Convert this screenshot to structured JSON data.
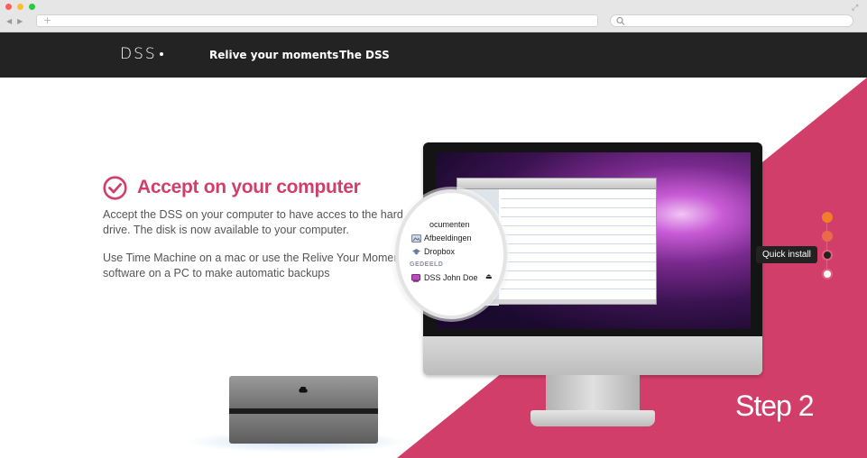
{
  "browser": {
    "window_buttons": [
      {
        "name": "close",
        "color": "#fe5f57"
      },
      {
        "name": "minimize",
        "color": "#febc2e"
      },
      {
        "name": "maximize",
        "color": "#28c840"
      }
    ],
    "new_tab_symbol": "+",
    "icons": [
      "back-icon",
      "forward-icon",
      "search-icon",
      "fullscreen-icon"
    ]
  },
  "nav": {
    "logo": "DSS",
    "links": [
      "Relive your moments",
      "The DSS"
    ]
  },
  "step": {
    "heading": "Accept on your computer",
    "paragraph_1": "Accept the DSS on your computer to have acces to the hard drive. The disk is now available to your computer.",
    "paragraph_2": "Use Time Machine on a mac or use the Relive Your Moments software on a PC to make automatic backups",
    "label": "Step 2"
  },
  "magnifier": {
    "item_partial": "ocumenten",
    "items": [
      "Afbeeldingen",
      "Dropbox"
    ],
    "section": "GEDEELD",
    "shared_item": "DSS John Doe"
  },
  "stepper": {
    "tooltip": "Quick install",
    "steps": [
      {
        "state": "done",
        "color": "#f07e2a"
      },
      {
        "state": "done",
        "color": "#ec6a4c"
      },
      {
        "state": "current",
        "color": "#222222"
      },
      {
        "state": "upcoming",
        "color": "#ffffff"
      }
    ]
  },
  "colors": {
    "accent": "#d23e6a",
    "nav_background": "#232323"
  }
}
